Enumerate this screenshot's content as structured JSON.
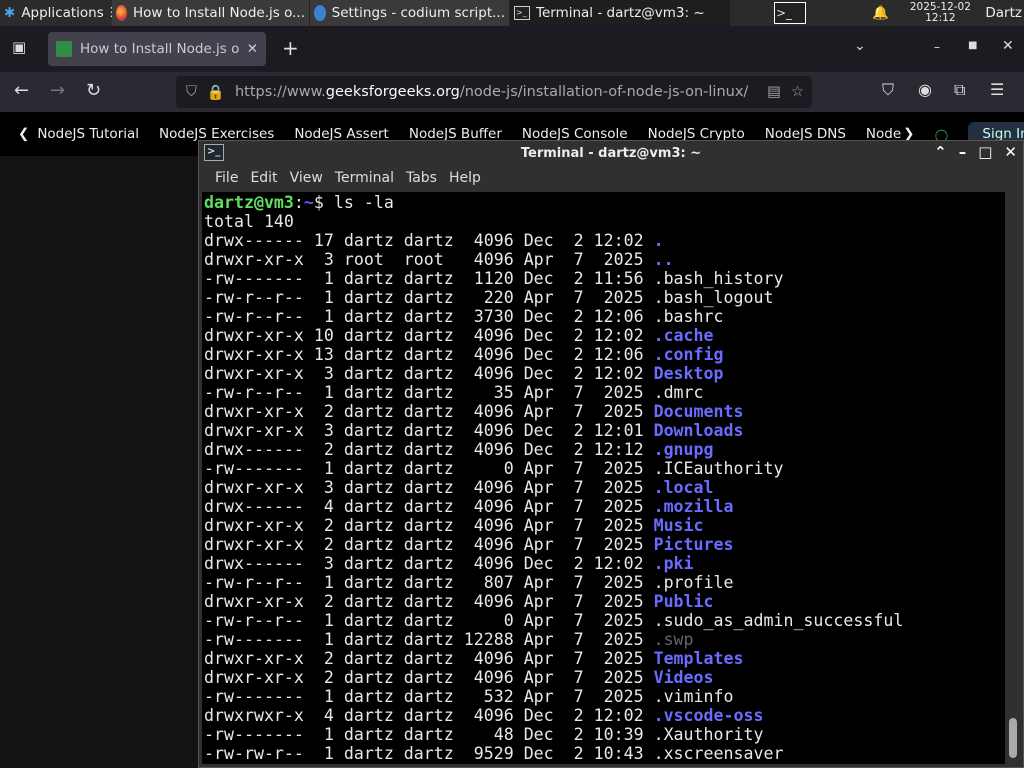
{
  "taskbar": {
    "applications": "Applications",
    "windows": [
      {
        "label": "How to Install Node.js o...",
        "icon": "firefox-icon"
      },
      {
        "label": "Settings - codium script...",
        "icon": "codium-icon"
      },
      {
        "label": "Terminal - dartz@vm3: ~",
        "icon": "terminal-icon"
      }
    ],
    "date": "2025-12-02",
    "time": "12:12",
    "user": "Dartz"
  },
  "browser": {
    "tab_title": "How to Install Node.js or",
    "url_prefix": "https://www.",
    "url_domain": "geeksforgeeks.org",
    "url_path": "/node-js/installation-of-node-js-on-linux/",
    "bookmarks": [
      "NodeJS Tutorial",
      "NodeJS Exercises",
      "NodeJS Assert",
      "NodeJS Buffer",
      "NodeJS Console",
      "NodeJS Crypto",
      "NodeJS DNS",
      "Node"
    ],
    "sign_in": "Sign In"
  },
  "terminal": {
    "title": "Terminal - dartz@vm3: ~",
    "menu": [
      "File",
      "Edit",
      "View",
      "Terminal",
      "Tabs",
      "Help"
    ],
    "prompt_user": "dartz@vm3",
    "prompt_sep": ":",
    "prompt_path": "~",
    "prompt_tail": "$ ls -la",
    "total": "total 140",
    "rows": [
      {
        "meta": "drwx------ 17 dartz dartz  4096 Dec  2 12:02 ",
        "name": ".",
        "kind": "dir"
      },
      {
        "meta": "drwxr-xr-x  3 root  root   4096 Apr  7  2025 ",
        "name": "..",
        "kind": "dir"
      },
      {
        "meta": "-rw-------  1 dartz dartz  1120 Dec  2 11:56 ",
        "name": ".bash_history",
        "kind": "file"
      },
      {
        "meta": "-rw-r--r--  1 dartz dartz   220 Apr  7  2025 ",
        "name": ".bash_logout",
        "kind": "file"
      },
      {
        "meta": "-rw-r--r--  1 dartz dartz  3730 Dec  2 12:06 ",
        "name": ".bashrc",
        "kind": "file"
      },
      {
        "meta": "drwxr-xr-x 10 dartz dartz  4096 Dec  2 12:02 ",
        "name": ".cache",
        "kind": "dir"
      },
      {
        "meta": "drwxr-xr-x 13 dartz dartz  4096 Dec  2 12:06 ",
        "name": ".config",
        "kind": "dir"
      },
      {
        "meta": "drwxr-xr-x  3 dartz dartz  4096 Dec  2 12:02 ",
        "name": "Desktop",
        "kind": "dir"
      },
      {
        "meta": "-rw-r--r--  1 dartz dartz    35 Apr  7  2025 ",
        "name": ".dmrc",
        "kind": "file"
      },
      {
        "meta": "drwxr-xr-x  2 dartz dartz  4096 Apr  7  2025 ",
        "name": "Documents",
        "kind": "dir"
      },
      {
        "meta": "drwxr-xr-x  3 dartz dartz  4096 Dec  2 12:01 ",
        "name": "Downloads",
        "kind": "dir"
      },
      {
        "meta": "drwx------  2 dartz dartz  4096 Dec  2 12:12 ",
        "name": ".gnupg",
        "kind": "dir"
      },
      {
        "meta": "-rw-------  1 dartz dartz     0 Apr  7  2025 ",
        "name": ".ICEauthority",
        "kind": "file"
      },
      {
        "meta": "drwxr-xr-x  3 dartz dartz  4096 Apr  7  2025 ",
        "name": ".local",
        "kind": "dir"
      },
      {
        "meta": "drwx------  4 dartz dartz  4096 Apr  7  2025 ",
        "name": ".mozilla",
        "kind": "dir"
      },
      {
        "meta": "drwxr-xr-x  2 dartz dartz  4096 Apr  7  2025 ",
        "name": "Music",
        "kind": "dir"
      },
      {
        "meta": "drwxr-xr-x  2 dartz dartz  4096 Apr  7  2025 ",
        "name": "Pictures",
        "kind": "dir"
      },
      {
        "meta": "drwx------  3 dartz dartz  4096 Dec  2 12:02 ",
        "name": ".pki",
        "kind": "dir"
      },
      {
        "meta": "-rw-r--r--  1 dartz dartz   807 Apr  7  2025 ",
        "name": ".profile",
        "kind": "file"
      },
      {
        "meta": "drwxr-xr-x  2 dartz dartz  4096 Apr  7  2025 ",
        "name": "Public",
        "kind": "dir"
      },
      {
        "meta": "-rw-r--r--  1 dartz dartz     0 Apr  7  2025 ",
        "name": ".sudo_as_admin_successful",
        "kind": "file"
      },
      {
        "meta": "-rw-------  1 dartz dartz 12288 Apr  7  2025 ",
        "name": ".swp",
        "kind": "dim"
      },
      {
        "meta": "drwxr-xr-x  2 dartz dartz  4096 Apr  7  2025 ",
        "name": "Templates",
        "kind": "dir"
      },
      {
        "meta": "drwxr-xr-x  2 dartz dartz  4096 Apr  7  2025 ",
        "name": "Videos",
        "kind": "dir"
      },
      {
        "meta": "-rw-------  1 dartz dartz   532 Apr  7  2025 ",
        "name": ".viminfo",
        "kind": "file"
      },
      {
        "meta": "drwxrwxr-x  4 dartz dartz  4096 Dec  2 12:02 ",
        "name": ".vscode-oss",
        "kind": "dir"
      },
      {
        "meta": "-rw-------  1 dartz dartz    48 Dec  2 10:39 ",
        "name": ".Xauthority",
        "kind": "file"
      },
      {
        "meta": "-rw-rw-r--  1 dartz dartz  9529 Dec  2 10:43 ",
        "name": ".xscreensaver",
        "kind": "file"
      }
    ]
  },
  "colors": {
    "directory": "#6b6bff",
    "prompt_user": "#5ee05e",
    "terminal_bg": "#000000"
  }
}
